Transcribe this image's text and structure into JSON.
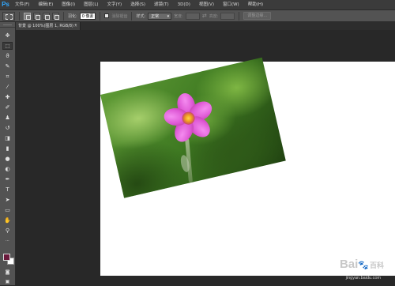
{
  "app": {
    "logo": "Ps"
  },
  "menubar": {
    "items": [
      "文件(F)",
      "编辑(E)",
      "图像(I)",
      "图层(L)",
      "文字(Y)",
      "选择(S)",
      "滤镜(T)",
      "3D(D)",
      "视图(V)",
      "窗口(W)",
      "帮助(H)"
    ]
  },
  "options": {
    "feather_label": "羽化:",
    "feather_value": "0 像素",
    "antialias_label": "消除锯齿",
    "style_label": "样式:",
    "style_value": "正常",
    "width_label": "宽度:",
    "height_label": "高度:",
    "refine_edge": "调整边缘..."
  },
  "document": {
    "tab_title": "背景 @ 100%(图层 1, RGB/8) *",
    "tab_close": "×"
  },
  "watermark": {
    "brand": "Bai",
    "brand_end": "百科",
    "url": "jingyan.baidu.com"
  },
  "colors": {
    "foreground": "#6b1a3c",
    "background": "#ffffff",
    "accent": "#31a8ff"
  },
  "tools": [
    "move-icon",
    "marquee-icon",
    "lasso-icon",
    "quick-select-icon",
    "crop-icon",
    "eyedropper-icon",
    "healing-icon",
    "brush-icon",
    "clone-stamp-icon",
    "history-brush-icon",
    "eraser-icon",
    "gradient-icon",
    "blur-icon",
    "dodge-icon",
    "pen-icon",
    "type-icon",
    "path-select-icon",
    "shape-icon",
    "hand-icon",
    "zoom-icon"
  ]
}
